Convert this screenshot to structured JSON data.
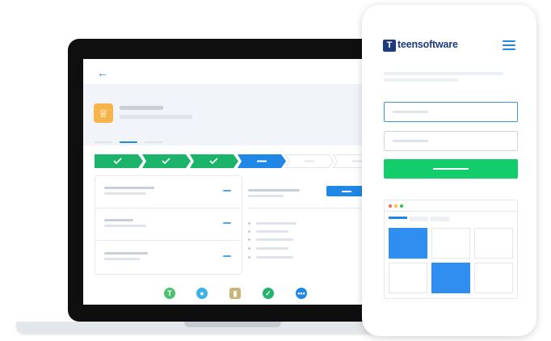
{
  "brand": {
    "logo_mark": "T",
    "name": "teensoftware",
    "color": "#1d3b7a"
  },
  "laptop_app": {
    "back_icon": "arrow-left-icon",
    "header_icon": "crown-icon",
    "steps_completed": 3,
    "steps_total": 6,
    "bottom_icons": [
      "teensoftware-icon",
      "chat-icon",
      "clipboard-icon",
      "check-icon",
      "more-icon"
    ]
  },
  "phone_app": {
    "menu_icon": "hamburger-menu-icon",
    "window_dots": [
      "#ff5f57",
      "#febc2e",
      "#28c840"
    ],
    "grid_highlighted": [
      0,
      4
    ]
  },
  "colors": {
    "accent": "#1f87e5",
    "success": "#12cd6a",
    "step_done": "#1bb46a",
    "crown": "#f7b44a"
  }
}
